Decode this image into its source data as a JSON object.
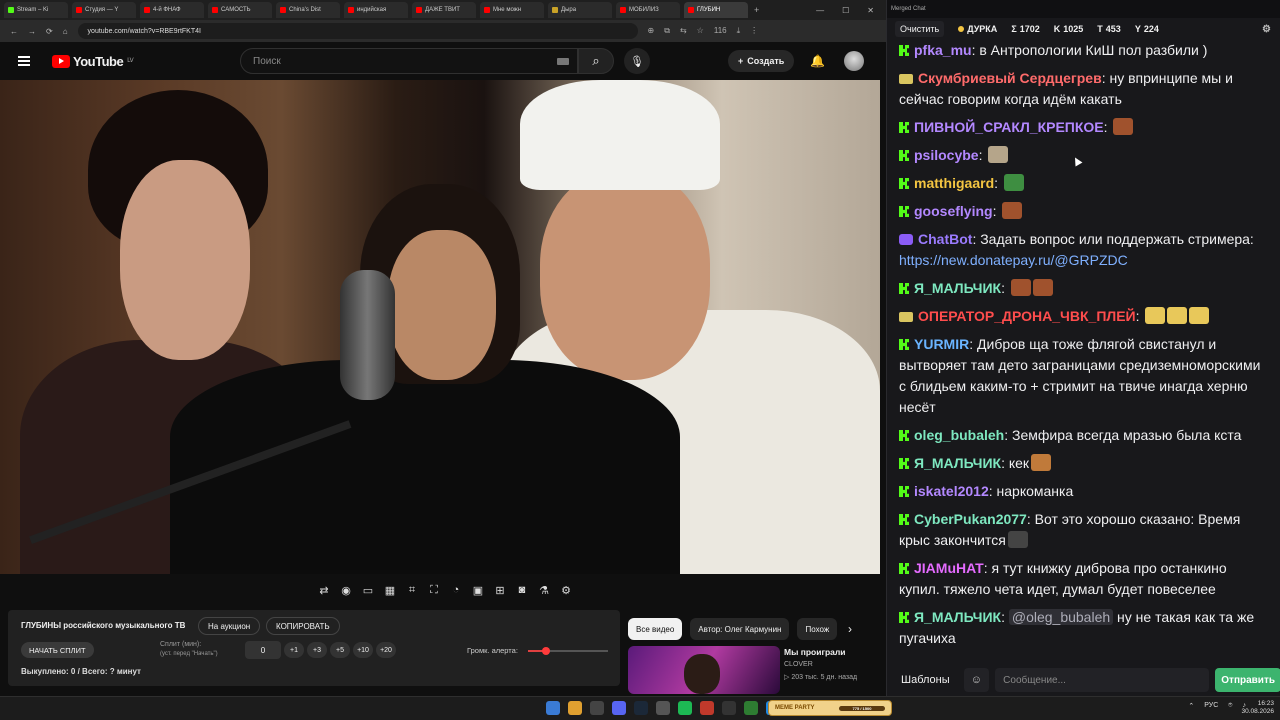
{
  "browser": {
    "tabs": [
      {
        "label": "Stream – Ki",
        "color": "#53fc18"
      },
      {
        "label": "Студия — Y",
        "color": "#ff0000"
      },
      {
        "label": "4-й ФНАФ",
        "color": "#ff0000"
      },
      {
        "label": "САМОСТЬ",
        "color": "#ff0000"
      },
      {
        "label": "China's Dist",
        "color": "#ff0000"
      },
      {
        "label": "индийская",
        "color": "#ff0000"
      },
      {
        "label": "ДАЖЕ ТВИТ",
        "color": "#ff0000"
      },
      {
        "label": "Мне можн",
        "color": "#ff0000"
      },
      {
        "label": "Дыра",
        "color": "#c9a227"
      },
      {
        "label": "МОБИЛИЗ",
        "color": "#ff0000"
      },
      {
        "label": "ГЛУБИН",
        "color": "#ff0000"
      }
    ],
    "url": "youtube.com/watch?v=RBE9rtFKT4I",
    "extension_badge": "116"
  },
  "youtube": {
    "logo_text": "YouTube",
    "region": "LV",
    "search_placeholder": "Поиск",
    "create_label": "Создать"
  },
  "player_tools": [
    "repeat-icon",
    "broadcast-icon",
    "screen-icon",
    "clapper-icon",
    "crop-icon",
    "fullscreen-icon",
    "speed-icon",
    "pip-icon",
    "add-icon",
    "camera-icon",
    "flask-icon",
    "gear-icon"
  ],
  "panel": {
    "title": "ГЛУБИНЫ российского музыкального ТВ",
    "auction_label": "На аукцион",
    "copy_label": "КОПИРОВАТЬ",
    "split_label": "НАЧАТЬ СПЛИТ",
    "split_min_label": "Сплит (мин):",
    "split_hint": "(уст. перед \"Начать\")",
    "split_value": "0",
    "increments": [
      "+1",
      "+3",
      "+5",
      "+10",
      "+20"
    ],
    "paid_status": "Выкуплено: 0 / Всего: ? минут",
    "volume_label": "Громк. алерта:",
    "volume_level": 0.23
  },
  "recommendations": {
    "chips": [
      "Все видео",
      "Автор: Олег Кармунин",
      "Похож"
    ],
    "item": {
      "title": "Мы проиграли",
      "channel": "CLOVER",
      "meta": "▷ 203 тыс.  5 дн. назад"
    }
  },
  "chat": {
    "window_title": "Merged Chat",
    "clear_label": "Очистить",
    "streamer_name": "ДУРКА",
    "stats": [
      {
        "symbol": "Σ",
        "value": "1702"
      },
      {
        "symbol": "K",
        "value": "1025"
      },
      {
        "symbol": "T",
        "value": "453"
      },
      {
        "symbol": "Y",
        "value": "224"
      }
    ],
    "messages": [
      {
        "platform": "kick",
        "user": "pfka_mu",
        "color": "#b388ff",
        "text": "в Антропологии КиШ пол разбили )",
        "emotes": []
      },
      {
        "platform": "twitch",
        "user": "Скумбриевый Сердцегрев",
        "color": "#ff6b6b",
        "text": "ну впринципе мы и сейчас говорим когда идём какать",
        "emotes": []
      },
      {
        "platform": "kick",
        "user": "ПИВНОЙ_СРАКЛ_КРЕПКОЕ",
        "color": "#b388ff",
        "text": "",
        "emotes": [
          "#a0522d"
        ]
      },
      {
        "platform": "kick",
        "user": "psilocybe",
        "color": "#b388ff",
        "text": "",
        "emotes": [
          "#b5a58a"
        ]
      },
      {
        "platform": "kick",
        "user": "matthigaard",
        "color": "#f4c542",
        "text": "",
        "emotes": [
          "#3e8e41"
        ]
      },
      {
        "platform": "kick",
        "user": "gooseflying",
        "color": "#b388ff",
        "text": "",
        "emotes": [
          "#a0522d"
        ]
      },
      {
        "platform": "bot",
        "user": "ChatBot",
        "color": "#9b7bff",
        "text": "Задать вопрос или поддержать стримера:",
        "link": "https://new.donatepay.ru/@GRPZDC",
        "emotes": []
      },
      {
        "platform": "kick",
        "user": "Я_МАЛЬЧИК",
        "color": "#7ee8c0",
        "text": "",
        "emotes": [
          "#a0522d",
          "#a0522d"
        ]
      },
      {
        "platform": "twitch",
        "user": "ОПЕРАТОР_ДРОНА_ЧВК_ПЛЕЙ",
        "color": "#ff4d4d",
        "text": "",
        "emotes": [
          "#e8c85a",
          "#e8c85a",
          "#e8c85a"
        ]
      },
      {
        "platform": "kick",
        "user": "YURMIR",
        "color": "#6ab4ff",
        "text": "Дибров ща тоже флягой свистанул и вытворяет там дето заграницами средиземноморскими с блидьем каким-то + стримит на твиче инагда херню несёт",
        "emotes": []
      },
      {
        "platform": "kick",
        "user": "oleg_bubaleh",
        "color": "#7ee8c0",
        "text": "Земфира всегда мразью была кста",
        "emotes": []
      },
      {
        "platform": "kick",
        "user": "Я_МАЛЬЧИК",
        "color": "#7ee8c0",
        "text": "кек",
        "emotes": [
          "#c07a3a"
        ]
      },
      {
        "platform": "kick",
        "user": "iskatel2012",
        "color": "#b388ff",
        "text": "наркоманка",
        "emotes": []
      },
      {
        "platform": "kick",
        "user": "CyberPukan2077",
        "color": "#7ee8c0",
        "text": "Вот это хорошо сказано: Время крыс закончится",
        "emotes": [
          "#444444"
        ]
      },
      {
        "platform": "kick",
        "user": "JIAMuHAT",
        "color": "#e56bff",
        "text": "я тут книжку диброва про останкино купил. тяжело чета идет, думал будет повеселее",
        "emotes": []
      },
      {
        "platform": "kick",
        "user": "Я_МАЛЬЧИК",
        "color": "#7ee8c0",
        "mention": "@oleg_bubaleh",
        "text": "ну не такая как та же пугачиха",
        "emotes": []
      }
    ],
    "templates_label": "Шаблоны",
    "input_placeholder": "Сообщение...",
    "send_label": "Отправить"
  },
  "taskbar": {
    "widget_label": "MEME PARTY",
    "widget_progress": "775 / 1500",
    "language": "РУС",
    "time": "16:23",
    "date": "30.08.2026"
  }
}
